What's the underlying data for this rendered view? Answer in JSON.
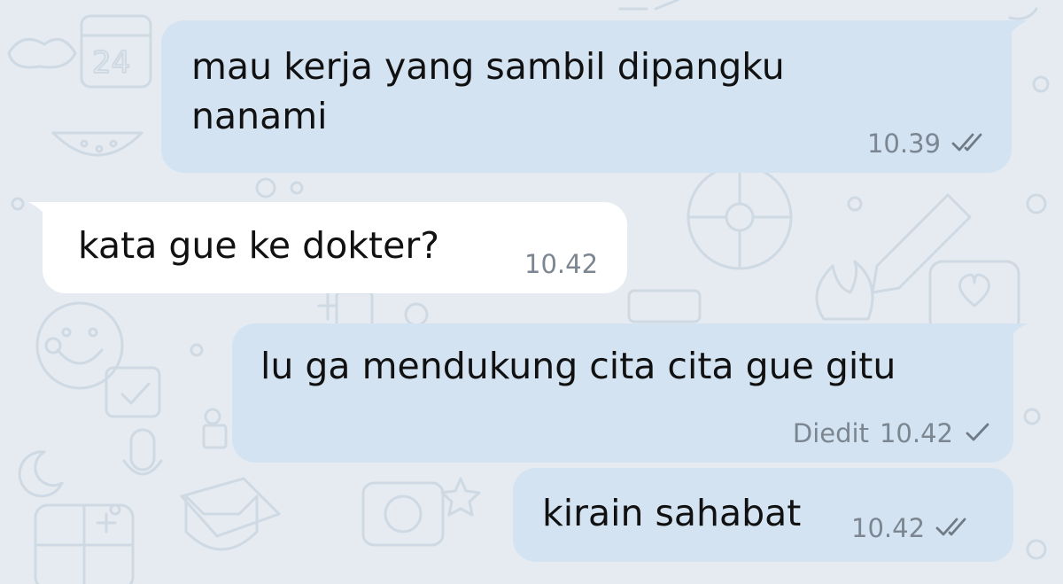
{
  "chat": {
    "messages": [
      {
        "direction": "outgoing",
        "lines": [
          "mau kerja yang sambil dipangku",
          "nanami"
        ],
        "edited_label": "",
        "time": "10.39",
        "status_icon": "double-check-icon"
      },
      {
        "direction": "incoming",
        "lines": [
          "kata gue ke dokter?"
        ],
        "edited_label": "",
        "time": "10.42",
        "status_icon": ""
      },
      {
        "direction": "outgoing",
        "lines": [
          "lu ga mendukung cita cita gue gitu"
        ],
        "edited_label": "Diedit",
        "time": "10.42",
        "status_icon": "single-check-icon"
      },
      {
        "direction": "outgoing",
        "lines": [
          "kirain sahabat"
        ],
        "edited_label": "",
        "time": "10.42",
        "status_icon": "double-check-icon"
      }
    ]
  },
  "colors": {
    "wallpaper": "#e5ebf1",
    "outgoing_bubble": "#d3e3f2",
    "incoming_bubble": "#ffffff",
    "meta_text": "#7c8690"
  }
}
